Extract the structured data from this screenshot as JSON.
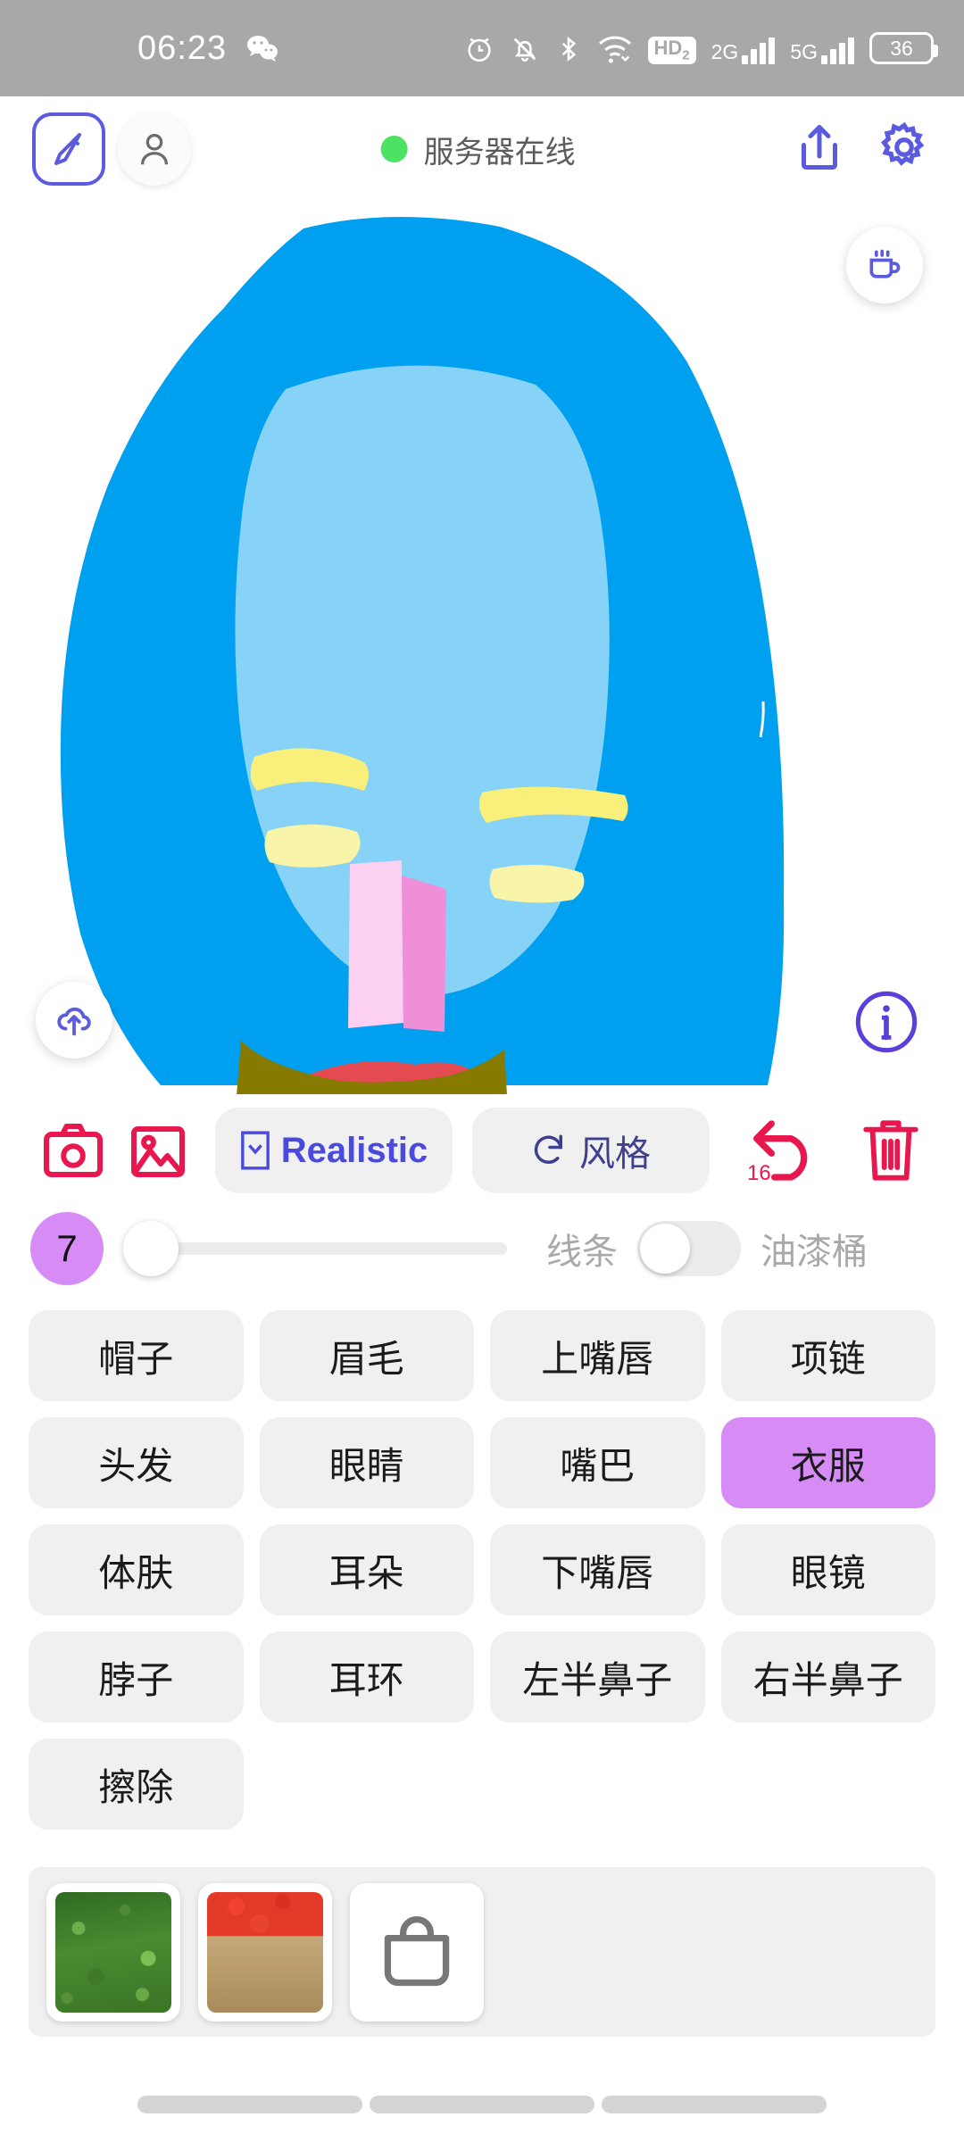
{
  "status_bar": {
    "time": "06:23",
    "app_icon": "wechat-icon",
    "icons": [
      "alarm-icon",
      "bell-muted-icon",
      "bluetooth-icon",
      "wifi-icon"
    ],
    "hd_badge": "HD",
    "hd_badge_sub": "2",
    "network_1": "2G",
    "network_2": "5G",
    "battery": "36"
  },
  "app_header": {
    "brush_tool": "brush-icon",
    "avatar": "user-avatar-icon",
    "server_status_text": "服务器在线",
    "server_status_color": "#4ce364",
    "share_icon": "share-upload-icon",
    "settings_icon": "gear-icon"
  },
  "canvas": {
    "coffee_button": "coffee-cup-icon",
    "cloud_button": "cloud-upload-icon",
    "info_button": "info-icon",
    "colors": {
      "hair": "#00a0f0",
      "skin": "#87d2f7",
      "eyebrow": "#f8f07a",
      "eye": "#f8f4a8",
      "nose_left": "#f9c6e8",
      "nose_right": "#ee8fd8",
      "upper_lip": "#e34a52",
      "lower_lip": "#b5176a",
      "clothes": "#867a00"
    }
  },
  "toolbar": {
    "camera_icon": "camera-icon",
    "gallery_icon": "image-icon",
    "realistic_label": "Realistic",
    "realistic_icon": "dropdown-box-icon",
    "style_label": "风格",
    "style_icon": "refresh-icon",
    "undo_icon": "undo-icon",
    "undo_count": "16",
    "delete_icon": "trash-icon",
    "accent_pink": "#e8174d",
    "accent_blue": "#4a4ae0"
  },
  "slider_row": {
    "brush_size": "7",
    "brush_size_color": "#d78cf5",
    "slider_value": 0,
    "lines_label": "线条",
    "bucket_label": "油漆桶",
    "toggle_state": "off"
  },
  "part_grid": {
    "selected": "衣服",
    "items": [
      "帽子",
      "眉毛",
      "上嘴唇",
      "项链",
      "头发",
      "眼睛",
      "嘴巴",
      "衣服",
      "体肤",
      "耳朵",
      "下嘴唇",
      "眼镜",
      "脖子",
      "耳环",
      "左半鼻子",
      "右半鼻子",
      "擦除"
    ]
  },
  "texture_tray": {
    "swatches": [
      "green-foliage-texture",
      "red-autumn-texture"
    ],
    "shop_icon": "shopping-bag-icon"
  },
  "nav_bar": {
    "segments": 3
  }
}
